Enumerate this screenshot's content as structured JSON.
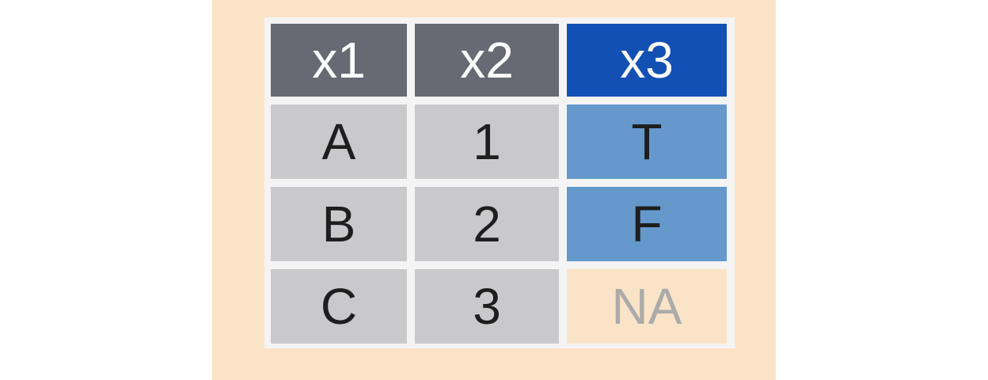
{
  "table": {
    "columns": [
      {
        "label": "x1",
        "highlighted": false
      },
      {
        "label": "x2",
        "highlighted": false
      },
      {
        "label": "x3",
        "highlighted": true
      }
    ],
    "rows": [
      [
        "A",
        "1",
        "T"
      ],
      [
        "B",
        "2",
        "F"
      ],
      [
        "C",
        "3",
        "NA"
      ]
    ],
    "missing_value": "NA"
  },
  "colors": {
    "panel_background": "#fbe3c7",
    "header_gray": "#676a72",
    "header_blue": "#1350b4",
    "cell_gray": "#c9c9cb",
    "cell_blue": "#6599cc",
    "cell_missing": "#fbe3c7",
    "missing_text": "#ababab"
  }
}
